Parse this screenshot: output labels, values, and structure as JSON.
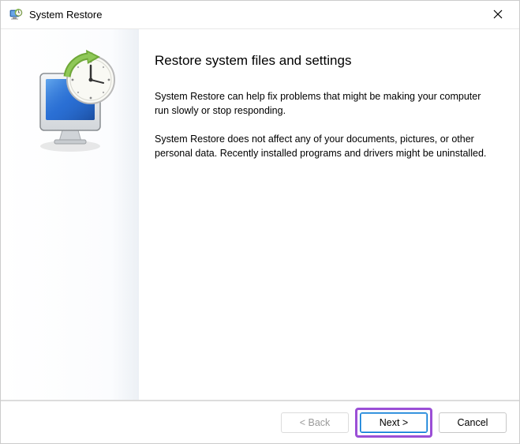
{
  "title_bar": {
    "title": "System Restore"
  },
  "content": {
    "heading": "Restore system files and settings",
    "paragraph1": "System Restore can help fix problems that might be making your computer run slowly or stop responding.",
    "paragraph2": "System Restore does not affect any of your documents, pictures, or other personal data. Recently installed programs and drivers might be uninstalled."
  },
  "footer": {
    "back_label": "< Back",
    "next_label": "Next >",
    "cancel_label": "Cancel"
  }
}
